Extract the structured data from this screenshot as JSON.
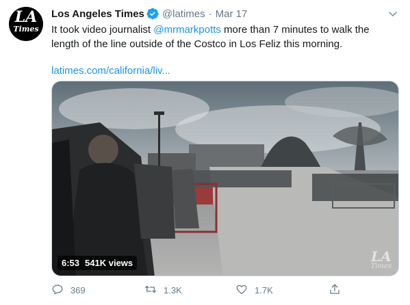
{
  "tweet": {
    "author_name": "Los Angeles Times",
    "handle": "@latimes",
    "separator": "·",
    "date": "Mar 17",
    "text_before": "It took video journalist ",
    "mention": "@mrmarkpotts",
    "text_after": " more than 7 minutes to walk the length of the line outside of the Costco in Los Feliz this morning.",
    "link": "latimes.com/california/liv...",
    "avatar": {
      "line1": "LA",
      "line2": "Times"
    }
  },
  "video": {
    "duration": "6:53",
    "views": "541K views",
    "watermark_line1": "LA",
    "watermark_line2": "Times"
  },
  "actions": {
    "reply_count": "369",
    "retweet_count": "1.3K",
    "like_count": "1.7K"
  },
  "icons": {
    "verified": "verified-badge-icon",
    "caret": "chevron-down-icon",
    "reply": "reply-icon",
    "retweet": "retweet-icon",
    "like": "heart-icon",
    "share": "share-icon"
  },
  "colors": {
    "link": "#1b95e0",
    "secondary_text": "#657786",
    "verified": "#1da1f2"
  }
}
